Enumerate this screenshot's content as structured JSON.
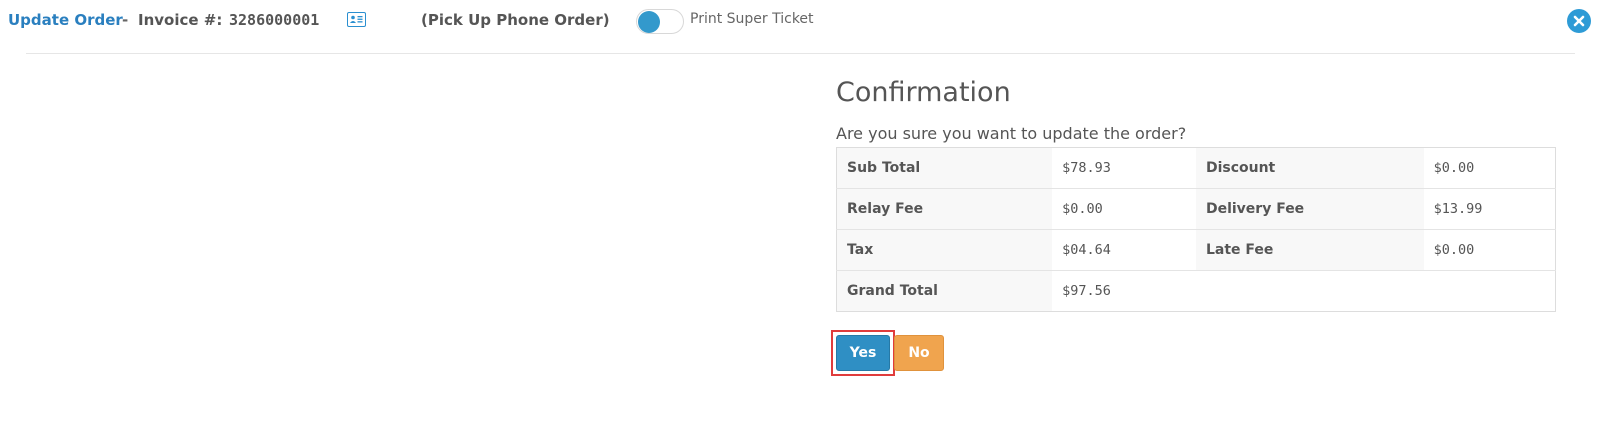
{
  "header": {
    "title_link": "Update Order",
    "separator": "-",
    "invoice_label": "Invoice #:",
    "invoice_number": "3286000001",
    "contact_icon": "id-card-icon",
    "order_type": "(Pick Up Phone Order)",
    "toggle_label": "Print Super Ticket",
    "toggle_on": false,
    "close_icon": "close-icon"
  },
  "confirmation": {
    "title": "Confirmation",
    "message": "Are you sure you want to update the order?"
  },
  "summary": {
    "rows": [
      {
        "label1": "Sub Total",
        "value1": "$78.93",
        "label2": "Discount",
        "value2": "$0.00"
      },
      {
        "label1": "Relay Fee",
        "value1": "$0.00",
        "label2": "Delivery Fee",
        "value2": "$13.99"
      },
      {
        "label1": "Tax",
        "value1": "$04.64",
        "label2": "Late Fee",
        "value2": "$0.00"
      },
      {
        "label1": "Grand Total",
        "value1": "$97.56"
      }
    ]
  },
  "buttons": {
    "yes_label": "Yes",
    "no_label": "No"
  },
  "colors": {
    "accent": "#2a7fbf",
    "yes_button": "#2f8fc4",
    "no_button": "#f0a44e",
    "highlight": "#e03c3c"
  }
}
